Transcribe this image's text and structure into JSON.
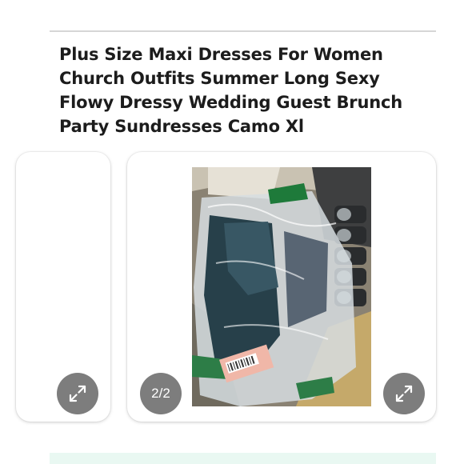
{
  "product": {
    "title": "Plus Size Maxi Dresses For Women Church Outfits Summer Long Sexy Flowy Dressy Wedding Guest Brunch Party Sundresses Camo Xl"
  },
  "gallery": {
    "counter": "2/2",
    "expand_icon": "expand-arrows-icon"
  },
  "colors": {
    "button_bg": "#7d7d7d",
    "title_text": "#1c1c1c",
    "strip_bg": "#e9f8f2"
  }
}
